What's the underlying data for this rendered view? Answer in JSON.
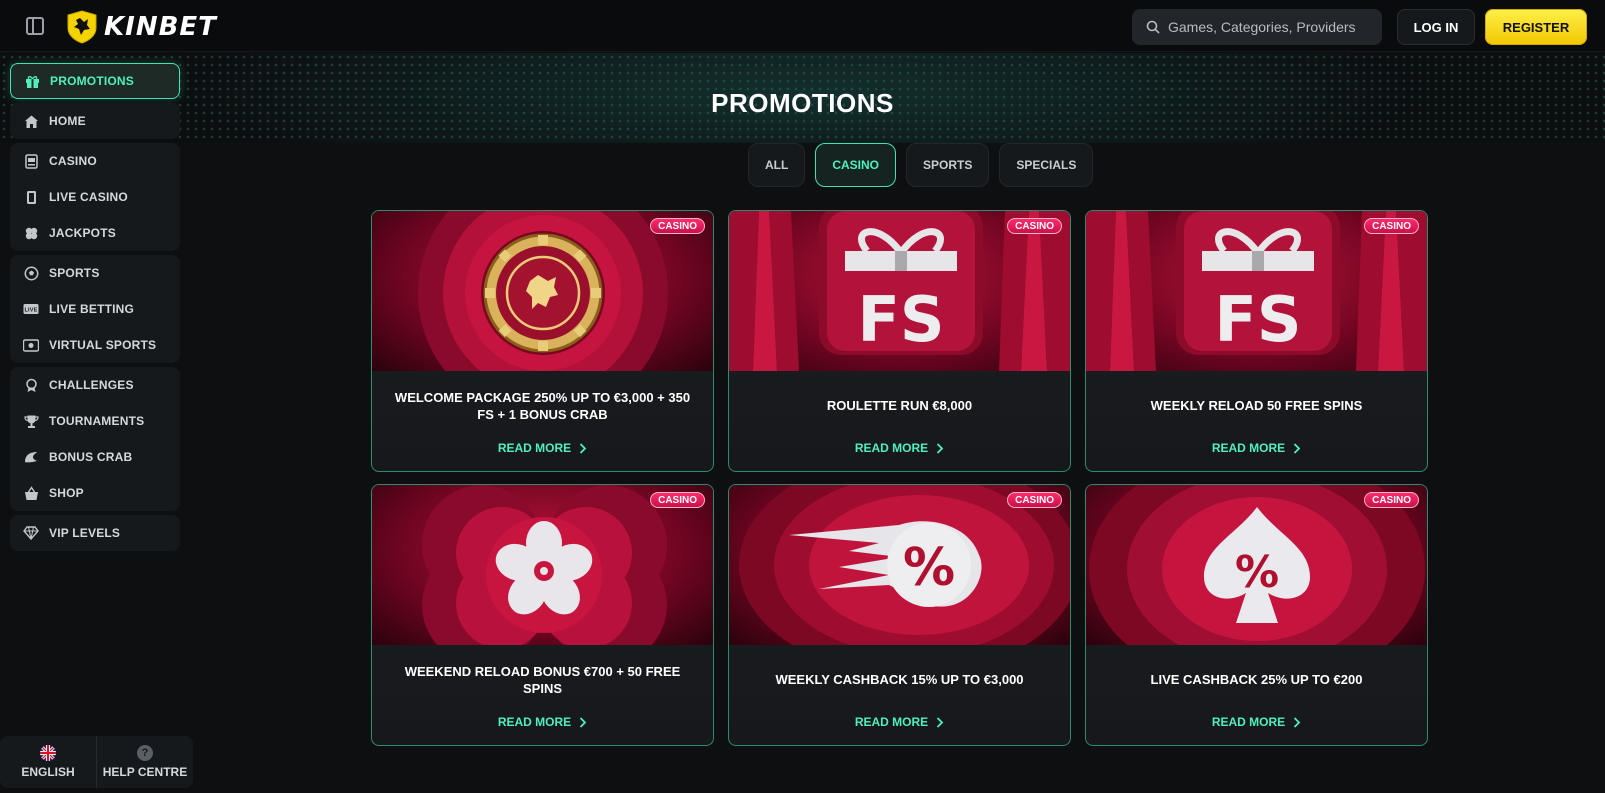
{
  "header": {
    "logo_text": "KINBET",
    "search_placeholder": "Games, Categories, Providers",
    "login_label": "LOG IN",
    "register_label": "REGISTER"
  },
  "sidebar": {
    "groups": [
      [
        {
          "label": "PROMOTIONS",
          "icon": "gift-icon",
          "active": true
        }
      ],
      [
        {
          "label": "HOME",
          "icon": "home-icon"
        }
      ],
      [
        {
          "label": "CASINO",
          "icon": "slot-machine-icon"
        },
        {
          "label": "LIVE CASINO",
          "icon": "cards-icon"
        },
        {
          "label": "JACKPOTS",
          "icon": "clover-icon"
        }
      ],
      [
        {
          "label": "SPORTS",
          "icon": "football-icon"
        },
        {
          "label": "LIVE BETTING",
          "icon": "live-icon"
        },
        {
          "label": "VIRTUAL SPORTS",
          "icon": "virtual-icon"
        }
      ],
      [
        {
          "label": "CHALLENGES",
          "icon": "medal-icon"
        },
        {
          "label": "TOURNAMENTS",
          "icon": "trophy-icon"
        },
        {
          "label": "BONUS CRAB",
          "icon": "crab-icon"
        },
        {
          "label": "SHOP",
          "icon": "basket-icon"
        }
      ],
      [
        {
          "label": "VIP LEVELS",
          "icon": "diamond-icon"
        }
      ]
    ],
    "footer": {
      "language_label": "ENGLISH",
      "help_label": "HELP CENTRE"
    }
  },
  "main": {
    "title": "PROMOTIONS",
    "filters": [
      {
        "label": "ALL",
        "active": false
      },
      {
        "label": "CASINO",
        "active": true
      },
      {
        "label": "SPORTS",
        "active": false
      },
      {
        "label": "SPECIALS",
        "active": false
      }
    ],
    "cards": [
      {
        "badge": "CASINO",
        "title": "WELCOME PACKAGE 250% UP TO €3,000 + 350 FS + 1 BONUS CRAB",
        "cta": "READ MORE",
        "art": "coin"
      },
      {
        "badge": "CASINO",
        "title": "ROULETTE RUN €8,000",
        "cta": "READ MORE",
        "art": "gift-fs"
      },
      {
        "badge": "CASINO",
        "title": "WEEKLY RELOAD 50 FREE SPINS",
        "cta": "READ MORE",
        "art": "gift-fs"
      },
      {
        "badge": "CASINO",
        "title": "WEEKEND RELOAD BONUS €700 + 50 FREE SPINS",
        "cta": "READ MORE",
        "art": "flower"
      },
      {
        "badge": "CASINO",
        "title": "WEEKLY CASHBACK 15% UP TO €3,000",
        "cta": "READ MORE",
        "art": "percent-comet"
      },
      {
        "badge": "CASINO",
        "title": "LIVE CASHBACK 25% UP TO €200",
        "cta": "READ MORE",
        "art": "percent-spade"
      }
    ]
  },
  "colors": {
    "accent": "#3fe3b0",
    "brand_yellow": "#f2c700",
    "badge_pink": "#ff2c6c"
  }
}
